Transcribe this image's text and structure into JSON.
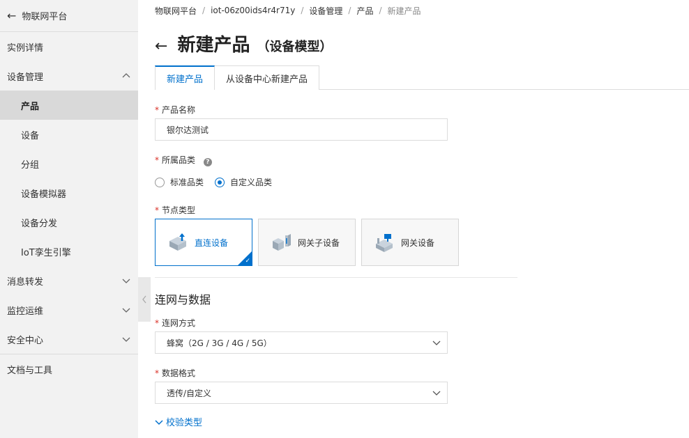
{
  "sidebar": {
    "header": "物联网平台",
    "items": [
      {
        "label": "实例详情"
      },
      {
        "label": "设备管理"
      },
      {
        "label": "产品"
      },
      {
        "label": "设备"
      },
      {
        "label": "分组"
      },
      {
        "label": "设备模拟器"
      },
      {
        "label": "设备分发"
      },
      {
        "label": "IoT孪生引擎"
      },
      {
        "label": "消息转发"
      },
      {
        "label": "监控运维"
      },
      {
        "label": "安全中心"
      },
      {
        "label": "文档与工具"
      }
    ]
  },
  "breadcrumb": [
    "物联网平台",
    "iot-06z00ids4r4r71y",
    "设备管理",
    "产品",
    "新建产品"
  ],
  "page": {
    "title": "新建产品",
    "subtitle": "（设备模型）"
  },
  "tabs": [
    "新建产品",
    "从设备中心新建产品"
  ],
  "form": {
    "product_name_label": "产品名称",
    "product_name_value": "银尔达测试",
    "category_label": "所属品类",
    "category_options": [
      "标准品类",
      "自定义品类"
    ],
    "node_type_label": "节点类型",
    "node_types": [
      "直连设备",
      "网关子设备",
      "网关设备"
    ],
    "section_title": "连网与数据",
    "network_label": "连网方式",
    "network_value": "蜂窝（2G / 3G / 4G / 5G）",
    "data_format_label": "数据格式",
    "data_format_value": "透传/自定义",
    "verify_link": "校验类型"
  },
  "colors": {
    "accent": "#0070cc",
    "required": "#d93026",
    "sidebar_bg": "#f2f2f2"
  }
}
